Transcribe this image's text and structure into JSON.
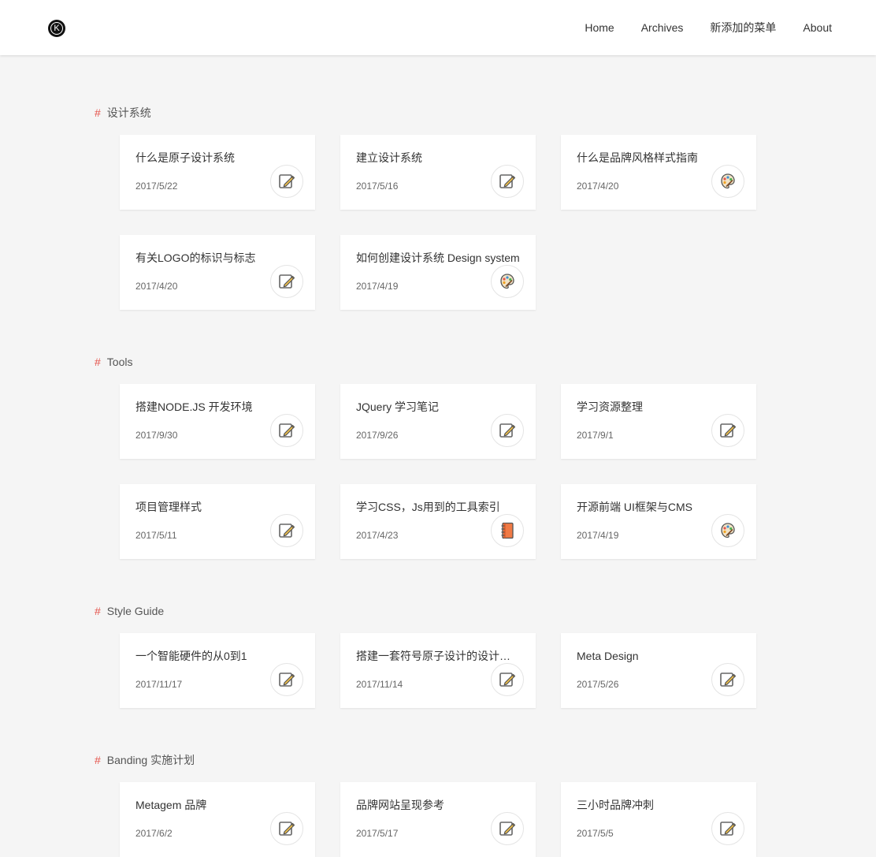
{
  "header": {
    "logo_letter": "K",
    "nav": [
      "Home",
      "Archives",
      "新添加的菜单",
      "About"
    ]
  },
  "sections": [
    {
      "hash": "#",
      "title": "设计系统",
      "cards": [
        {
          "title": "什么是原子设计系统",
          "date": "2017/5/22",
          "icon": "pencil-note-icon"
        },
        {
          "title": "建立设计系统",
          "date": "2017/5/16",
          "icon": "pencil-note-icon"
        },
        {
          "title": "什么是品牌风格样式指南",
          "date": "2017/4/20",
          "icon": "palette-icon"
        },
        {
          "title": "有关LOGO的标识与标志",
          "date": "2017/4/20",
          "icon": "pencil-note-icon"
        },
        {
          "title": "如何创建设计系统 Design system",
          "date": "2017/4/19",
          "icon": "palette-icon"
        }
      ]
    },
    {
      "hash": "#",
      "title": "Tools",
      "cards": [
        {
          "title": "搭建NODE.JS 开发环境",
          "date": "2017/9/30",
          "icon": "pencil-note-icon"
        },
        {
          "title": "JQuery 学习笔记",
          "date": "2017/9/26",
          "icon": "pencil-note-icon"
        },
        {
          "title": "学习资源整理",
          "date": "2017/9/1",
          "icon": "pencil-note-icon"
        },
        {
          "title": "项目管理样式",
          "date": "2017/5/11",
          "icon": "pencil-note-icon"
        },
        {
          "title": "学习CSS，Js用到的工具索引",
          "date": "2017/4/23",
          "icon": "notebook-icon"
        },
        {
          "title": "开源前端 UI框架与CMS",
          "date": "2017/4/19",
          "icon": "palette-icon"
        }
      ]
    },
    {
      "hash": "#",
      "title": "Style Guide",
      "cards": [
        {
          "title": "一个智能硬件的从0到1",
          "date": "2017/11/17",
          "icon": "pencil-note-icon"
        },
        {
          "title": "搭建一套符号原子设计的设计…",
          "date": "2017/11/14",
          "icon": "pencil-note-icon"
        },
        {
          "title": "Meta Design",
          "date": "2017/5/26",
          "icon": "pencil-note-icon"
        }
      ]
    },
    {
      "hash": "#",
      "title": "Banding 实施计划",
      "cards": [
        {
          "title": "Metagem 品牌",
          "date": "2017/6/2",
          "icon": "pencil-note-icon"
        },
        {
          "title": "品牌网站呈现参考",
          "date": "2017/5/17",
          "icon": "pencil-note-icon"
        },
        {
          "title": "三小时品牌冲刺",
          "date": "2017/5/5",
          "icon": "pencil-note-icon"
        }
      ]
    }
  ],
  "colors": {
    "accent_hash": "#e5534b",
    "background": "#f5f5f5",
    "card": "#ffffff"
  }
}
